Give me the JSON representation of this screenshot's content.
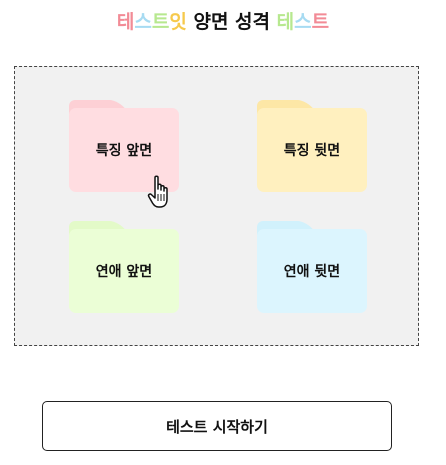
{
  "title": {
    "parts": [
      {
        "text": "테",
        "color": "#f28b96"
      },
      {
        "text": "스",
        "color": "#a7dbf2"
      },
      {
        "text": "트",
        "color": "#b7e88f"
      },
      {
        "text": "잇",
        "color": "#f6c94c"
      },
      {
        "text": " 양면 성격 ",
        "color": "#111111"
      },
      {
        "text": "테",
        "color": "#b7e88f"
      },
      {
        "text": "스",
        "color": "#a7dbf2"
      },
      {
        "text": "트",
        "color": "#f28b96"
      }
    ]
  },
  "folders": [
    {
      "label": "특징 앞면",
      "color": "#ffdde1",
      "icon": "folder-icon"
    },
    {
      "label": "특징 뒷면",
      "color": "#fff0bf",
      "icon": "folder-icon"
    },
    {
      "label": "연애 앞면",
      "color": "#ebfed6",
      "icon": "folder-icon"
    },
    {
      "label": "연애 뒷면",
      "color": "#dcf5fe",
      "icon": "folder-icon"
    }
  ],
  "cursor": {
    "icon": "hand-pointer-icon"
  },
  "start_button": {
    "label": "테스트 시작하기"
  }
}
